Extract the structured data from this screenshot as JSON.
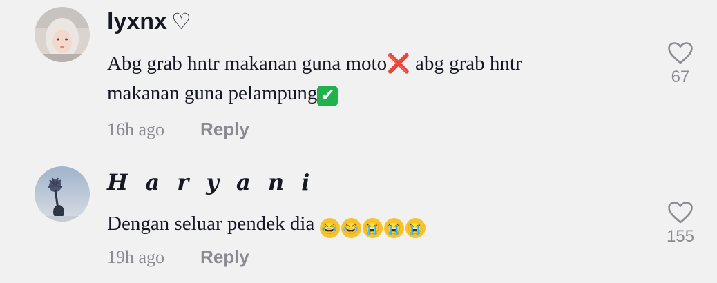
{
  "comments": [
    {
      "username": "lyxnx",
      "username_suffix": "♡",
      "text_part1": "Abg grab hntr makanan guna moto",
      "emoji_cross": "❌",
      "text_part2": " abg grab hntr makanan guna pelampung",
      "emoji_check": "✔",
      "timestamp": "16h ago",
      "reply_label": "Reply",
      "like_count": "67"
    },
    {
      "username": "𝓗𝓪𝓻𝔂𝓪𝓷𝓲",
      "username_display": "H a r y a n i",
      "text": "Dengan seluar pendek dia ",
      "emojis": [
        "rolling-on-floor-laughing",
        "rolling-on-floor-laughing",
        "crying-face",
        "crying-face",
        "crying-face"
      ],
      "timestamp": "19h ago",
      "reply_label": "Reply",
      "like_count": "155"
    }
  ],
  "colors": {
    "background": "#f1f1f2",
    "text": "#161823",
    "muted": "#8a8b91"
  }
}
